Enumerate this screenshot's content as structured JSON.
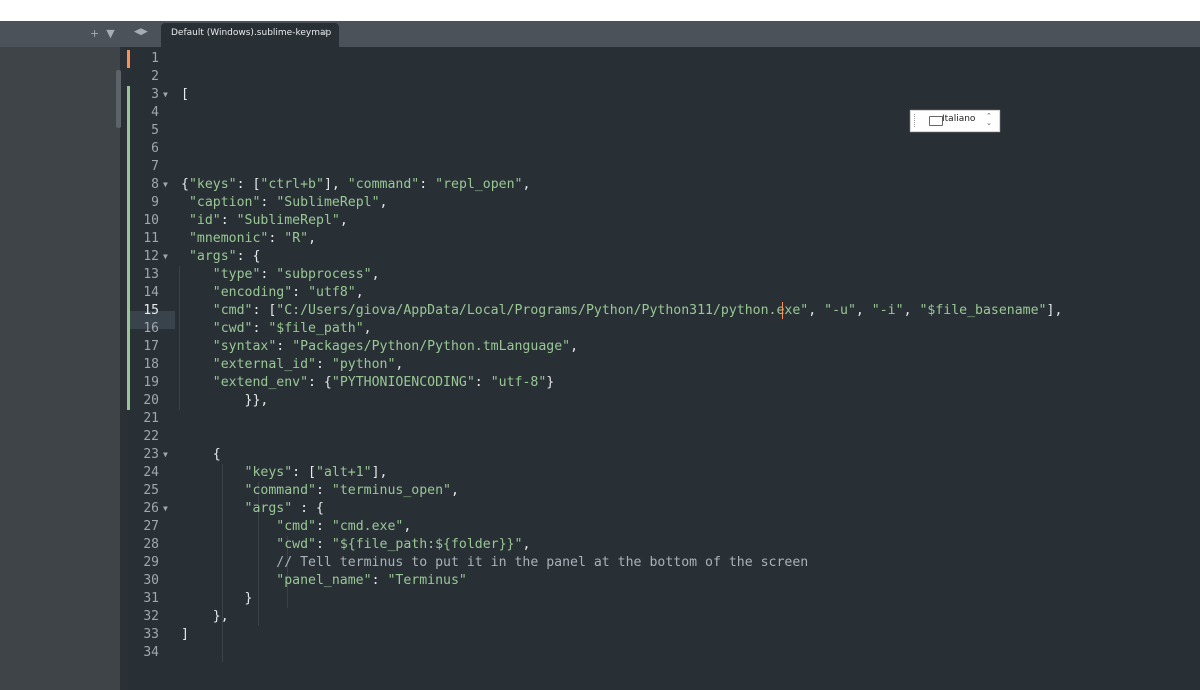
{
  "tabbar": {
    "new_tab_symbol": "+",
    "dropdown_symbol": "▼",
    "nav_prev": "◀",
    "nav_next": "▶",
    "active_tab": {
      "label": "Default (Windows).sublime-keymap",
      "close": "×"
    }
  },
  "ime_widget": {
    "label": "Italiano",
    "icon": "keyboard-icon",
    "min_symbol": "⌃",
    "restore_symbol": "⌄"
  },
  "editor": {
    "active_line": 15,
    "lines": [
      {
        "n": "1",
        "fold": "",
        "tokens": []
      },
      {
        "n": "2",
        "fold": "",
        "tokens": []
      },
      {
        "n": "3",
        "fold": "▼",
        "tokens": [
          {
            "t": "[",
            "c": "p"
          }
        ]
      },
      {
        "n": "4",
        "fold": "",
        "tokens": []
      },
      {
        "n": "5",
        "fold": "",
        "tokens": []
      },
      {
        "n": "6",
        "fold": "",
        "tokens": []
      },
      {
        "n": "7",
        "fold": "",
        "tokens": []
      },
      {
        "n": "8",
        "fold": "▼",
        "tokens": [
          {
            "t": "{",
            "c": "p"
          },
          {
            "t": "\"keys\"",
            "c": "s"
          },
          {
            "t": ": [",
            "c": "p"
          },
          {
            "t": "\"ctrl+b\"",
            "c": "s"
          },
          {
            "t": "], ",
            "c": "p"
          },
          {
            "t": "\"command\"",
            "c": "s"
          },
          {
            "t": ": ",
            "c": "p"
          },
          {
            "t": "\"repl_open\"",
            "c": "s"
          },
          {
            "t": ",",
            "c": "p"
          }
        ]
      },
      {
        "n": "9",
        "fold": "",
        "tokens": [
          {
            "t": " ",
            "c": "p"
          },
          {
            "t": "\"caption\"",
            "c": "s"
          },
          {
            "t": ": ",
            "c": "p"
          },
          {
            "t": "\"SublimeRepl\"",
            "c": "s"
          },
          {
            "t": ",",
            "c": "p"
          }
        ]
      },
      {
        "n": "10",
        "fold": "",
        "tokens": [
          {
            "t": " ",
            "c": "p"
          },
          {
            "t": "\"id\"",
            "c": "s"
          },
          {
            "t": ": ",
            "c": "p"
          },
          {
            "t": "\"SublimeRepl\"",
            "c": "s"
          },
          {
            "t": ",",
            "c": "p"
          }
        ]
      },
      {
        "n": "11",
        "fold": "",
        "tokens": [
          {
            "t": " ",
            "c": "p"
          },
          {
            "t": "\"mnemonic\"",
            "c": "s"
          },
          {
            "t": ": ",
            "c": "p"
          },
          {
            "t": "\"R\"",
            "c": "s"
          },
          {
            "t": ",",
            "c": "p"
          }
        ]
      },
      {
        "n": "12",
        "fold": "▼",
        "tokens": [
          {
            "t": " ",
            "c": "p"
          },
          {
            "t": "\"args\"",
            "c": "s"
          },
          {
            "t": ": {",
            "c": "p"
          }
        ]
      },
      {
        "n": "13",
        "fold": "",
        "tokens": [
          {
            "t": "    ",
            "c": "p"
          },
          {
            "t": "\"type\"",
            "c": "s"
          },
          {
            "t": ": ",
            "c": "p"
          },
          {
            "t": "\"subprocess\"",
            "c": "s"
          },
          {
            "t": ",",
            "c": "p"
          }
        ]
      },
      {
        "n": "14",
        "fold": "",
        "tokens": [
          {
            "t": "    ",
            "c": "p"
          },
          {
            "t": "\"encoding\"",
            "c": "s"
          },
          {
            "t": ": ",
            "c": "p"
          },
          {
            "t": "\"utf8\"",
            "c": "s"
          },
          {
            "t": ",",
            "c": "p"
          }
        ]
      },
      {
        "n": "15",
        "fold": "",
        "tokens": [
          {
            "t": "    ",
            "c": "p"
          },
          {
            "t": "\"cmd\"",
            "c": "s"
          },
          {
            "t": ": [",
            "c": "p"
          },
          {
            "t": "\"C:/Users/giova/AppData/Local/Programs/Python/Python311/python.exe\"",
            "c": "s"
          },
          {
            "t": ", ",
            "c": "p"
          },
          {
            "t": "\"-u\"",
            "c": "s"
          },
          {
            "t": ", ",
            "c": "p"
          },
          {
            "t": "\"-i\"",
            "c": "s"
          },
          {
            "t": ", ",
            "c": "p"
          },
          {
            "t": "\"$file_basename\"",
            "c": "s"
          },
          {
            "t": "],",
            "c": "p"
          }
        ]
      },
      {
        "n": "16",
        "fold": "",
        "tokens": [
          {
            "t": "    ",
            "c": "p"
          },
          {
            "t": "\"cwd\"",
            "c": "s"
          },
          {
            "t": ": ",
            "c": "p"
          },
          {
            "t": "\"$file_path\"",
            "c": "s"
          },
          {
            "t": ",",
            "c": "p"
          }
        ]
      },
      {
        "n": "17",
        "fold": "",
        "tokens": [
          {
            "t": "    ",
            "c": "p"
          },
          {
            "t": "\"syntax\"",
            "c": "s"
          },
          {
            "t": ": ",
            "c": "p"
          },
          {
            "t": "\"Packages/Python/Python.tmLanguage\"",
            "c": "s"
          },
          {
            "t": ",",
            "c": "p"
          }
        ]
      },
      {
        "n": "18",
        "fold": "",
        "tokens": [
          {
            "t": "    ",
            "c": "p"
          },
          {
            "t": "\"external_id\"",
            "c": "s"
          },
          {
            "t": ": ",
            "c": "p"
          },
          {
            "t": "\"python\"",
            "c": "s"
          },
          {
            "t": ",",
            "c": "p"
          }
        ]
      },
      {
        "n": "19",
        "fold": "",
        "tokens": [
          {
            "t": "    ",
            "c": "p"
          },
          {
            "t": "\"extend_env\"",
            "c": "s"
          },
          {
            "t": ": {",
            "c": "p"
          },
          {
            "t": "\"PYTHONIOENCODING\"",
            "c": "s"
          },
          {
            "t": ": ",
            "c": "p"
          },
          {
            "t": "\"utf-8\"",
            "c": "s"
          },
          {
            "t": "}",
            "c": "p"
          }
        ]
      },
      {
        "n": "20",
        "fold": "",
        "tokens": [
          {
            "t": "        }},",
            "c": "p"
          }
        ]
      },
      {
        "n": "21",
        "fold": "",
        "tokens": []
      },
      {
        "n": "22",
        "fold": "",
        "tokens": []
      },
      {
        "n": "23",
        "fold": "▼",
        "tokens": [
          {
            "t": "    {",
            "c": "p"
          }
        ]
      },
      {
        "n": "24",
        "fold": "",
        "tokens": [
          {
            "t": "        ",
            "c": "p"
          },
          {
            "t": "\"keys\"",
            "c": "s"
          },
          {
            "t": ": [",
            "c": "p"
          },
          {
            "t": "\"alt+1\"",
            "c": "s"
          },
          {
            "t": "],",
            "c": "p"
          }
        ]
      },
      {
        "n": "25",
        "fold": "",
        "tokens": [
          {
            "t": "        ",
            "c": "p"
          },
          {
            "t": "\"command\"",
            "c": "s"
          },
          {
            "t": ": ",
            "c": "p"
          },
          {
            "t": "\"terminus_open\"",
            "c": "s"
          },
          {
            "t": ",",
            "c": "p"
          }
        ]
      },
      {
        "n": "26",
        "fold": "▼",
        "tokens": [
          {
            "t": "        ",
            "c": "p"
          },
          {
            "t": "\"args\"",
            "c": "s"
          },
          {
            "t": " : {",
            "c": "p"
          }
        ]
      },
      {
        "n": "27",
        "fold": "",
        "tokens": [
          {
            "t": "            ",
            "c": "p"
          },
          {
            "t": "\"cmd\"",
            "c": "s"
          },
          {
            "t": ": ",
            "c": "p"
          },
          {
            "t": "\"cmd.exe\"",
            "c": "s"
          },
          {
            "t": ",",
            "c": "p"
          }
        ]
      },
      {
        "n": "28",
        "fold": "",
        "tokens": [
          {
            "t": "            ",
            "c": "p"
          },
          {
            "t": "\"cwd\"",
            "c": "s"
          },
          {
            "t": ": ",
            "c": "p"
          },
          {
            "t": "\"${file_path:${folder}}\"",
            "c": "s"
          },
          {
            "t": ",",
            "c": "p"
          }
        ]
      },
      {
        "n": "29",
        "fold": "",
        "tokens": [
          {
            "t": "            ",
            "c": "p"
          },
          {
            "t": "// Tell terminus to put it in the panel at the bottom of the screen",
            "c": "c"
          }
        ]
      },
      {
        "n": "30",
        "fold": "",
        "tokens": [
          {
            "t": "            ",
            "c": "p"
          },
          {
            "t": "\"panel_name\"",
            "c": "s"
          },
          {
            "t": ": ",
            "c": "p"
          },
          {
            "t": "\"Terminus\"",
            "c": "s"
          }
        ]
      },
      {
        "n": "31",
        "fold": "",
        "tokens": [
          {
            "t": "        }",
            "c": "p"
          }
        ]
      },
      {
        "n": "32",
        "fold": "",
        "tokens": [
          {
            "t": "    },",
            "c": "p"
          }
        ]
      },
      {
        "n": "33",
        "fold": "",
        "tokens": [
          {
            "t": "]",
            "c": "p"
          }
        ]
      },
      {
        "n": "34",
        "fold": "",
        "tokens": []
      }
    ]
  }
}
